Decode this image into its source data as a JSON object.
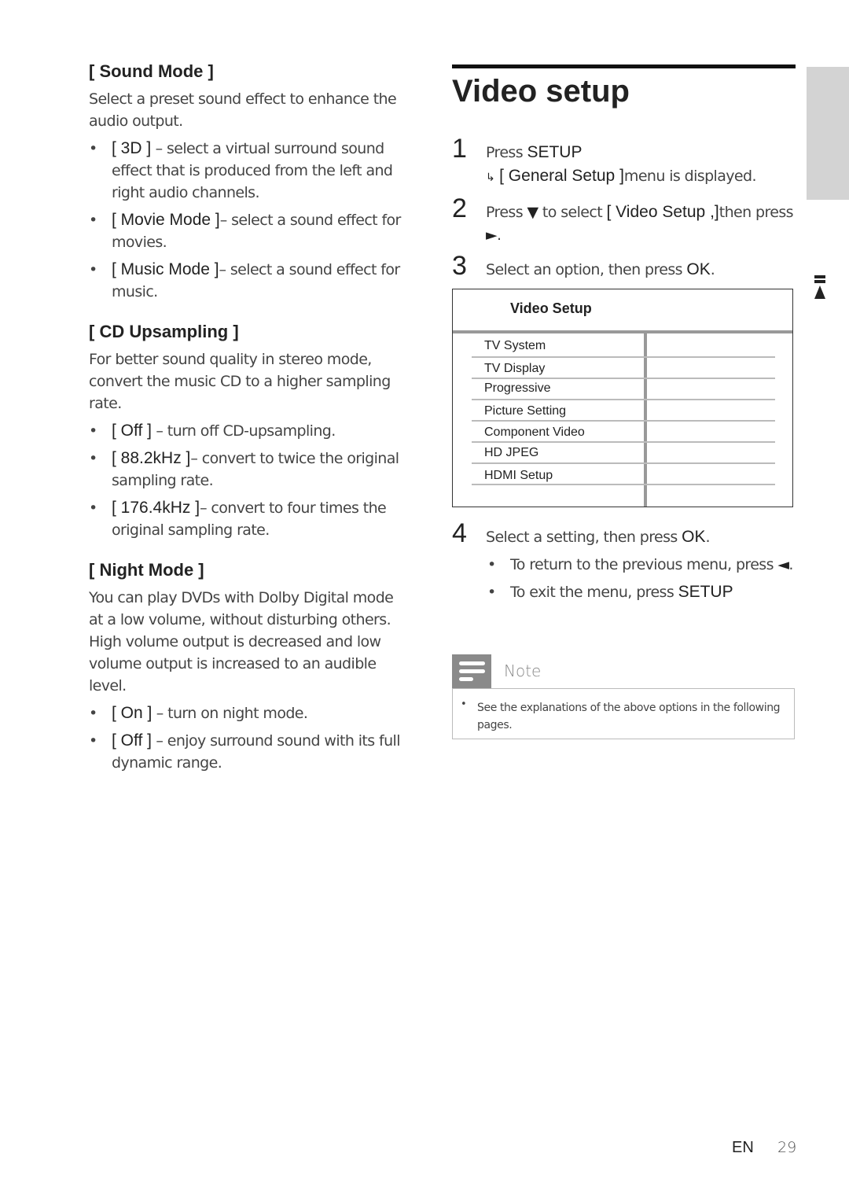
{
  "left_column": {
    "sound_mode": {
      "title": "[ Sound Mode ]",
      "description": "Select a preset sound effect to enhance the audio output.",
      "options": [
        {
          "key": "[ 3D ]",
          "text": " – select a virtual surround sound effect that is produced from the left and right audio channels."
        },
        {
          "key": "[ Movie Mode ]",
          "text": "– select a sound effect for movies."
        },
        {
          "key": "[ Music Mode ]",
          "text": "– select a sound effect for music."
        }
      ]
    },
    "cd_upsampling": {
      "title": "[ CD Upsampling ]",
      "description": "For better sound quality in stereo mode, convert the music CD to a higher sampling rate.",
      "options": [
        {
          "key": "[ Off ]",
          "text": " – turn off CD-upsampling."
        },
        {
          "key": "[ 88.2kHz ]",
          "text": "– convert to twice the original sampling rate."
        },
        {
          "key": "[ 176.4kHz ]",
          "text": "– convert to four times the original sampling rate."
        }
      ]
    },
    "night_mode": {
      "title": "[ Night Mode ]",
      "description": "You can play DVDs with Dolby Digital mode at a low volume, without disturbing others. High volume output is decreased and low volume output is increased to an audible level.",
      "options": [
        {
          "key": "[ On ]",
          "text": " – turn on night mode."
        },
        {
          "key": "[ Off ]",
          "text": " – enjoy surround sound with its full dynamic range."
        }
      ]
    }
  },
  "right_column": {
    "title": "Video setup",
    "steps": [
      {
        "num": "1",
        "pre": "Press ",
        "key": "SETUP",
        "post": ""
      },
      {
        "num": "2",
        "pre": "Press ",
        "arrow_down": "▼",
        "mid": " to select ",
        "key": "[ Video Setup ,]",
        "post": "then press ",
        "arrow_right": "►",
        "end": "."
      },
      {
        "num": "3",
        "pre": "Select an option, then press ",
        "key": "OK",
        "post": "."
      },
      {
        "num": "4",
        "pre": "Select a setting, then press ",
        "key": "OK",
        "post": "."
      }
    ],
    "step1_result": {
      "arrow": "↳",
      "key": "[ General Setup ]",
      "text": "menu is displayed."
    },
    "step4_bullets": [
      {
        "text": "To return to the previous menu, press ",
        "symbol": "◄",
        "end": "."
      },
      {
        "text": "To exit the menu, press ",
        "key": "SETUP"
      }
    ],
    "menu": {
      "header": "Video Setup",
      "items": [
        "TV System",
        "TV Display",
        "Progressive",
        "Picture Setting",
        "Component Video",
        "HD JPEG",
        "HDMI Setup"
      ]
    },
    "note": {
      "title": "Note",
      "bullet": "•",
      "text": "See the explanations of the above options in the following pages."
    }
  },
  "bullet": "•",
  "footer": {
    "language": "EN",
    "page": "29"
  }
}
